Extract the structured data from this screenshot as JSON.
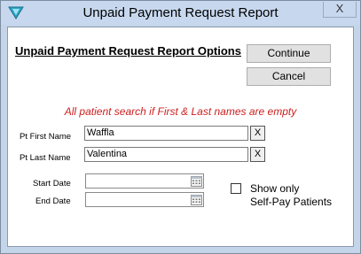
{
  "window": {
    "title": "Unpaid Payment Request Report",
    "close_glyph": "X"
  },
  "form": {
    "heading": "Unpaid Payment Request Report Options",
    "continue_label": "Continue",
    "cancel_label": "Cancel",
    "notice": "All patient search if First & Last names are empty",
    "notice_color": "#cc1f1f",
    "first_name": {
      "label": "Pt First Name",
      "value": "Waffla",
      "clear_label": "X"
    },
    "last_name": {
      "label": "Pt Last Name",
      "value": "Valentina",
      "clear_label": "X"
    },
    "start_date": {
      "label": "Start Date",
      "value": ""
    },
    "end_date": {
      "label": "End Date",
      "value": ""
    },
    "self_pay": {
      "label_line1": "Show only",
      "label_line2": "Self-Pay Patients",
      "checked": false
    }
  },
  "icons": {
    "app": "app-logo-icon",
    "calendar": "calendar-icon"
  }
}
